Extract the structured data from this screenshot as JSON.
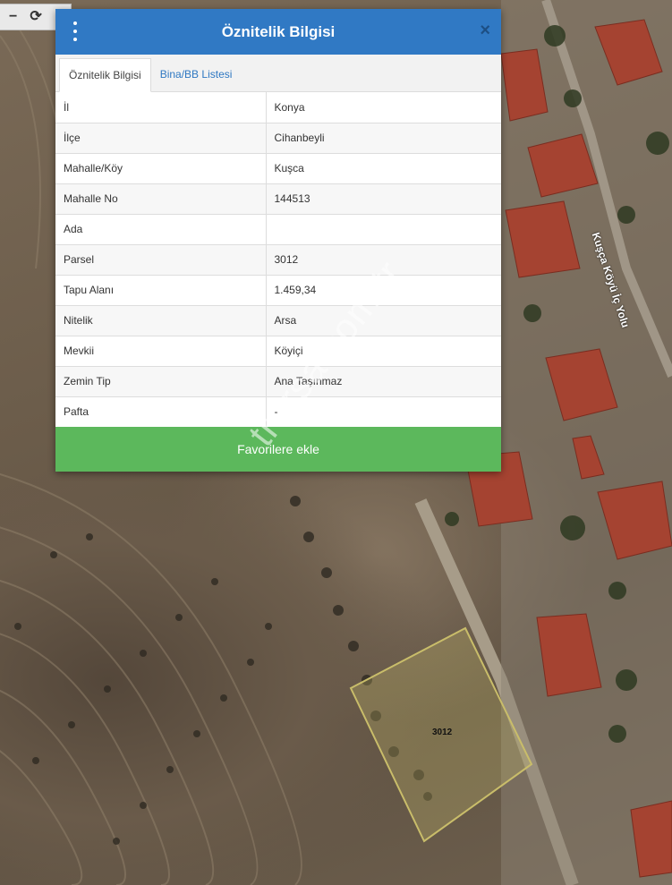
{
  "dialog": {
    "title": "Öznitelik Bilgisi",
    "close_glyph": "×",
    "tabs": [
      {
        "label": "Öznitelik Bilgisi",
        "active": true
      },
      {
        "label": "Bina/BB Listesi",
        "active": false
      }
    ],
    "rows": [
      {
        "key": "İl",
        "value": "Konya"
      },
      {
        "key": "İlçe",
        "value": "Cihanbeyli"
      },
      {
        "key": "Mahalle/Köy",
        "value": "Kuşca"
      },
      {
        "key": "Mahalle No",
        "value": "144513"
      },
      {
        "key": "Ada",
        "value": ""
      },
      {
        "key": "Parsel",
        "value": "3012"
      },
      {
        "key": "Tapu Alanı",
        "value": "1.459,34"
      },
      {
        "key": "Nitelik",
        "value": "Arsa"
      },
      {
        "key": "Mevkii",
        "value": "Köyiçi"
      },
      {
        "key": "Zemin Tip",
        "value": "Ana Taşınmaz"
      },
      {
        "key": "Pafta",
        "value": "-"
      }
    ],
    "favorite_button": "Favorilere ekle"
  },
  "toolbar": {
    "minus_glyph": "−",
    "refresh_glyph": "⟳"
  },
  "map": {
    "parcel_label": "3012",
    "road_label": "Kuşça Köyü İç Yolu"
  },
  "watermark": "trarsa.com.tr",
  "colors": {
    "header": "#3079c4",
    "button": "#5cb85c",
    "tab_link": "#2f78c2",
    "parcel_outline": "#c9bd6a"
  },
  "icons": [
    "menu-icon",
    "close-icon",
    "minus-icon",
    "refresh-icon"
  ]
}
